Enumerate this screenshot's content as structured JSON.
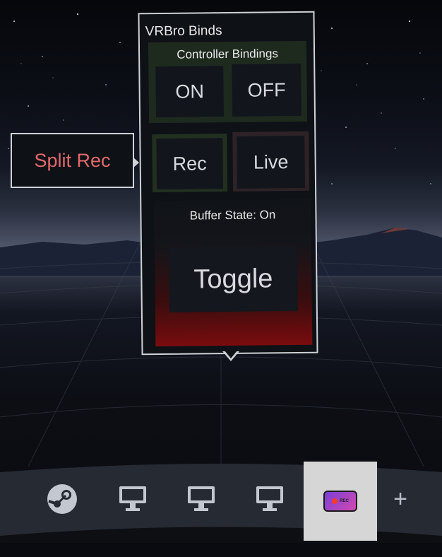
{
  "panel": {
    "title": "VRBro Binds",
    "controller_bindings": {
      "heading": "Controller Bindings",
      "on_label": "ON",
      "off_label": "OFF"
    },
    "mode": {
      "rec_label": "Rec",
      "live_label": "Live"
    },
    "buffer": {
      "state_text": "Buffer State: On",
      "toggle_label": "Toggle"
    }
  },
  "callout": {
    "label": "Split Rec"
  },
  "dock": {
    "items": [
      {
        "icon": "steam-icon"
      },
      {
        "icon": "monitor-icon"
      },
      {
        "icon": "monitor-icon"
      },
      {
        "icon": "monitor-icon"
      },
      {
        "icon": "rec-app-icon",
        "active": true,
        "badge": "REC"
      },
      {
        "icon": "plus-icon",
        "label": "+"
      }
    ]
  },
  "colors": {
    "accent_red": "#e0696c",
    "panel_bg": "#0e1116",
    "border": "#cfd2d6",
    "green_group": "#1f2a1f"
  }
}
